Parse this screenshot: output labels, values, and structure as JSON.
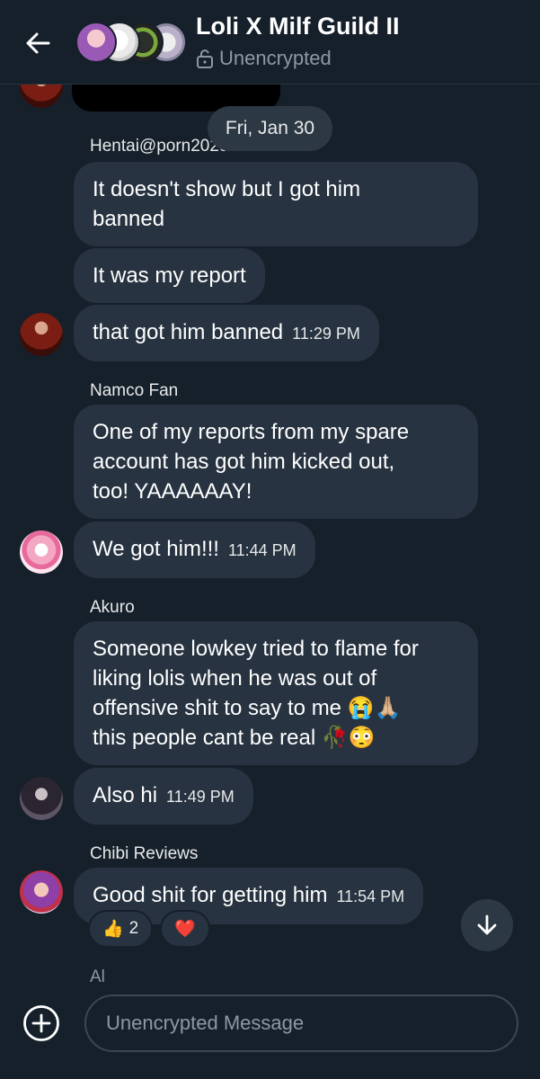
{
  "header": {
    "title": "Loli X Milf Guild II",
    "status": "Unencrypted"
  },
  "date_separator": "Fri, Jan 30",
  "messages": [
    {
      "sender": "Hentai@porn2025",
      "text": "It doesn't show but I got him\nbanned",
      "time": ""
    },
    {
      "sender": "",
      "text": "It was my report",
      "time": ""
    },
    {
      "sender": "",
      "text": "that got him banned",
      "time": "11:29 PM"
    },
    {
      "sender": "Namco Fan",
      "text": "One of my reports from my spare\naccount has got him kicked out,\ntoo!  YAAAAAAY!",
      "time": ""
    },
    {
      "sender": "",
      "text": "We got him!!!",
      "time": "11:44 PM"
    },
    {
      "sender": "Akuro",
      "text": "Someone lowkey tried to flame for\nliking lolis when he was out of\noffensive shit to say to me 😭🙏🏼\nthis people cant be real 🥀😳",
      "time": ""
    },
    {
      "sender": "",
      "text": "Also hi",
      "time": "11:49 PM"
    },
    {
      "sender": "Chibi Reviews",
      "text": "Good shit for getting him",
      "time": "11:54 PM"
    }
  ],
  "reactions": [
    {
      "emoji": "👍",
      "count": "2"
    },
    {
      "emoji": "❤️",
      "count": ""
    }
  ],
  "next_sender_peek": "Al",
  "composer": {
    "placeholder": "Unencrypted Message"
  },
  "icons": [
    "back-arrow-icon",
    "lock-open-icon",
    "add-circle-icon",
    "arrow-down-icon"
  ]
}
